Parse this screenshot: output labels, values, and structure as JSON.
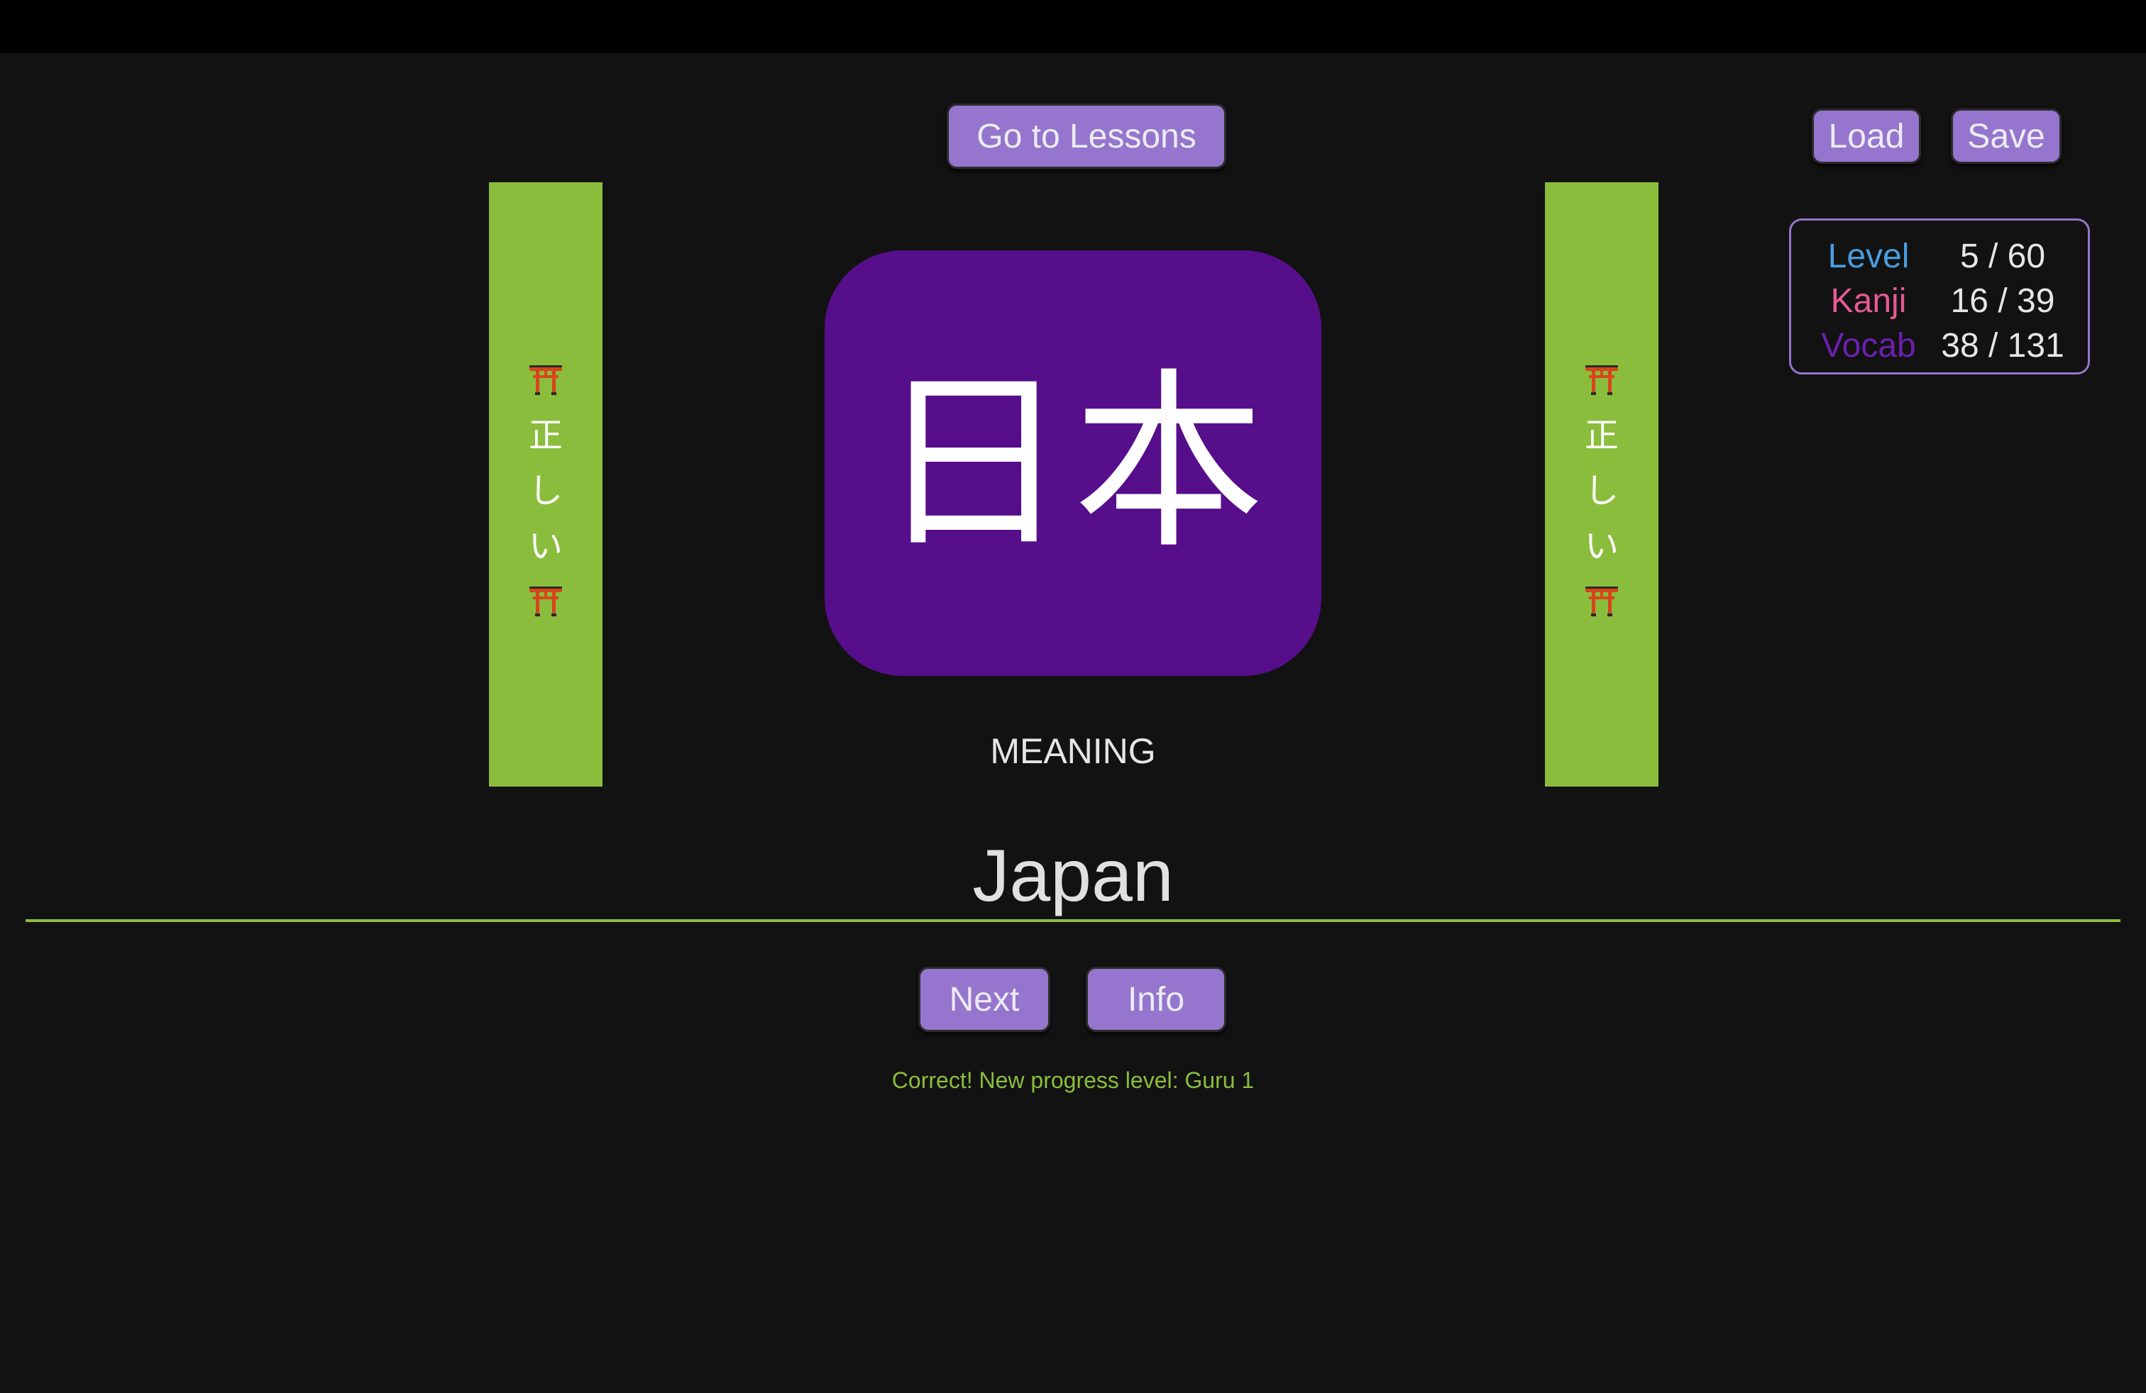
{
  "nav": {
    "lessons_label": "Go to Lessons",
    "load_label": "Load",
    "save_label": "Save"
  },
  "stats": {
    "level": {
      "label": "Level",
      "value": "5 / 60",
      "color": "#4a9de0"
    },
    "kanji": {
      "label": "Kanji",
      "value": "16 / 39",
      "color": "#e45b93"
    },
    "vocab": {
      "label": "Vocab",
      "value": "38 / 131",
      "color": "#6c1fae"
    }
  },
  "banner": {
    "text_chars": [
      "正",
      "し",
      "い"
    ],
    "icon": "torii-gate-icon",
    "color": "#8bbd3c"
  },
  "card": {
    "kanji": "日本",
    "color": "#560e8a"
  },
  "question": {
    "type_label": "MEANING"
  },
  "answer": {
    "value": "Japan"
  },
  "actions": {
    "next_label": "Next",
    "info_label": "Info"
  },
  "feedback": {
    "message": "Correct! New progress level: Guru 1"
  },
  "theme": {
    "accent": "#9575cd",
    "background": "#121212",
    "success": "#8bbd3c"
  }
}
